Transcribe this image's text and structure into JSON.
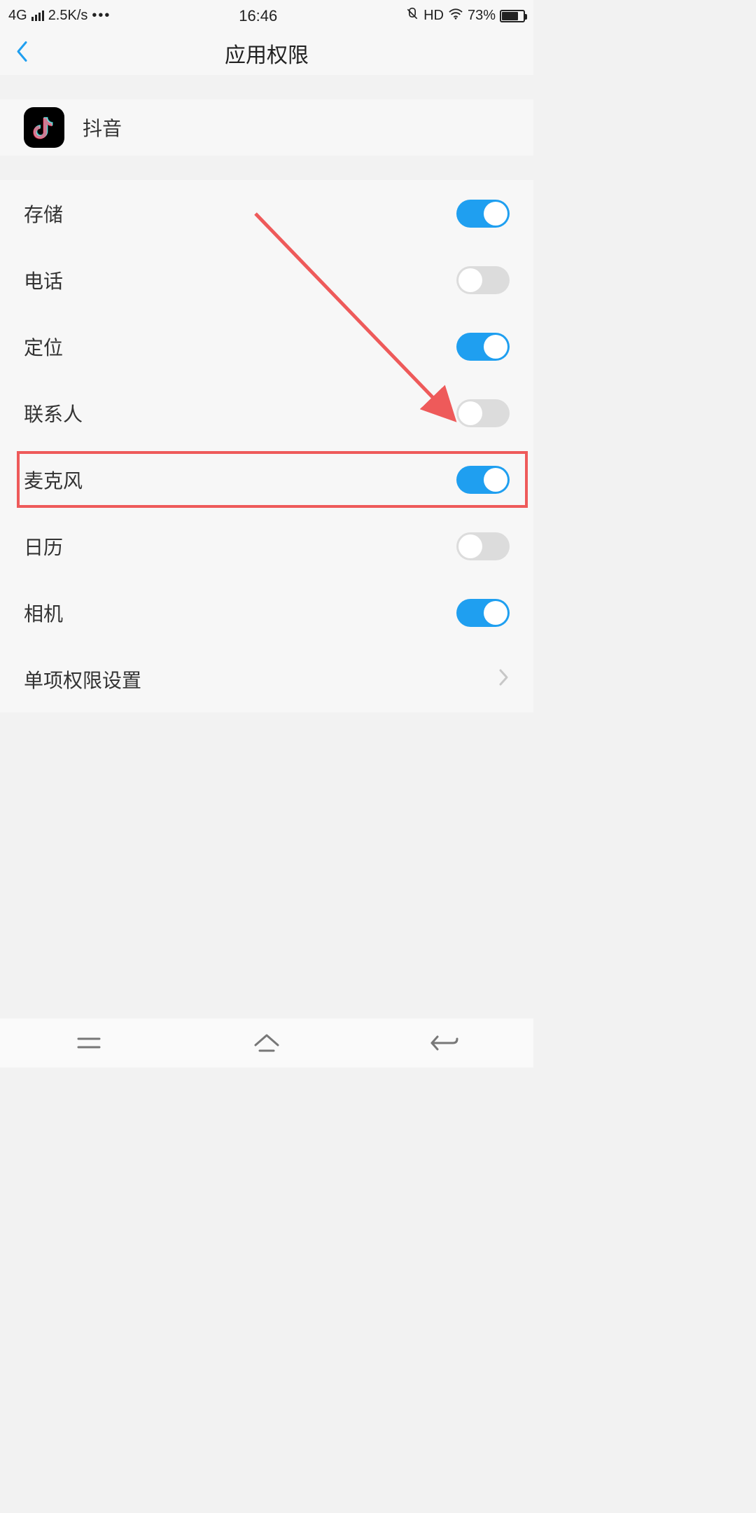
{
  "status": {
    "network": "4G",
    "speed": "2.5K/s",
    "time": "16:46",
    "hd": "HD",
    "battery_pct": "73%"
  },
  "header": {
    "title": "应用权限"
  },
  "app": {
    "name": "抖音"
  },
  "permissions": [
    {
      "label": "存储",
      "on": true,
      "highlighted": false
    },
    {
      "label": "电话",
      "on": false,
      "highlighted": false
    },
    {
      "label": "定位",
      "on": true,
      "highlighted": false
    },
    {
      "label": "联系人",
      "on": false,
      "highlighted": false
    },
    {
      "label": "麦克风",
      "on": true,
      "highlighted": true
    },
    {
      "label": "日历",
      "on": false,
      "highlighted": false
    },
    {
      "label": "相机",
      "on": true,
      "highlighted": false
    }
  ],
  "more": {
    "label": "单项权限设置"
  }
}
